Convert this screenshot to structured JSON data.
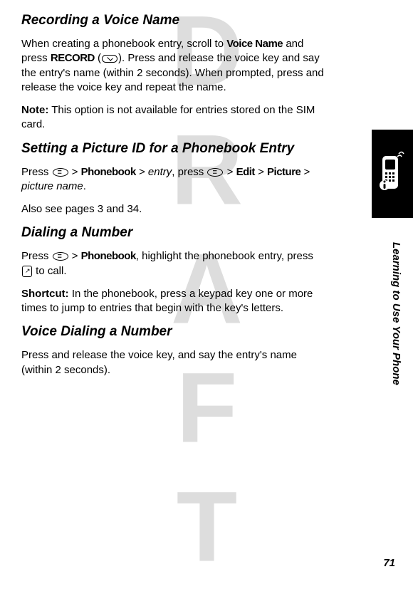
{
  "watermark": "DRAFT",
  "sections": {
    "recording": {
      "title": "Recording a Voice Name",
      "para1_parts": {
        "t1": "When creating a phonebook entry, scroll to ",
        "voicename": "Voice Name",
        "t2": " and press ",
        "record": "RECORD",
        "t3": " (",
        "t4": "). Press and release the voice key and say the entry's name (within 2 seconds). When prompted, press and release the voice key and repeat the name."
      },
      "note_label": "Note:",
      "note_text": " This option is not available for entries stored on the SIM card."
    },
    "picture": {
      "title": "Setting a Picture ID for a Phonebook Entry",
      "para_parts": {
        "t1": "Press ",
        "t2": " > ",
        "phonebook": "Phonebook",
        "t3": " > ",
        "entry": "entry",
        "t4": ", press ",
        "t5": " > ",
        "edit": "Edit",
        "t6": " > ",
        "picture": "Picture",
        "t7": " > ",
        "picturename": "picture name",
        "t8": "."
      },
      "para2": "Also see pages 3 and 34."
    },
    "dialing": {
      "title": "Dialing a Number",
      "para_parts": {
        "t1": "Press ",
        "t2": " > ",
        "phonebook": "Phonebook",
        "t3": ", highlight the phonebook entry, press ",
        "t4": " to call."
      },
      "shortcut_label": "Shortcut:",
      "shortcut_text": " In the phonebook, press a keypad key one or more times to jump to entries that begin with the key's letters."
    },
    "voicedialing": {
      "title": "Voice Dialing a Number",
      "para": "Press and release the voice key, and say the entry's name (within 2 seconds)."
    }
  },
  "sidebar_text": "Learning to Use Your Phone",
  "page_number": "71"
}
